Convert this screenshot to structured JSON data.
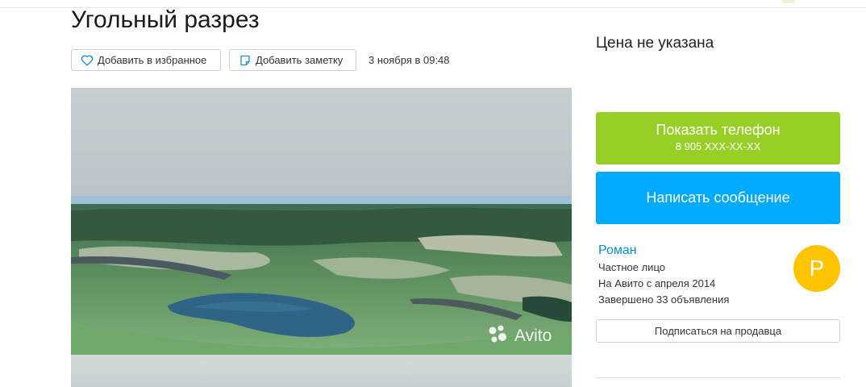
{
  "listing": {
    "title": "Угольный разрез",
    "favorite_label": "Добавить в избранное",
    "note_label": "Добавить заметку",
    "date": "3 ноября в 09:48",
    "watermark": "Avito"
  },
  "sidebar": {
    "price": "Цена не указана",
    "phone_button": {
      "label": "Показать телефон",
      "number": "8 905 XXX-XX-XX"
    },
    "message_button": "Написать сообщение",
    "seller": {
      "name": "Роман",
      "type": "Частное лицо",
      "since": "На Авито с апреля 2014",
      "completed": "Завершено 33 объявления",
      "avatar_letter": "Р"
    },
    "subscribe_button": "Подписаться на продавца"
  },
  "colors": {
    "phone_green": "#97cf26",
    "message_blue": "#00aaff",
    "link_blue": "#0091d9",
    "avatar_yellow": "#ffc400"
  },
  "icons": {
    "favorite": "heart-outline-icon",
    "note": "note-icon"
  }
}
